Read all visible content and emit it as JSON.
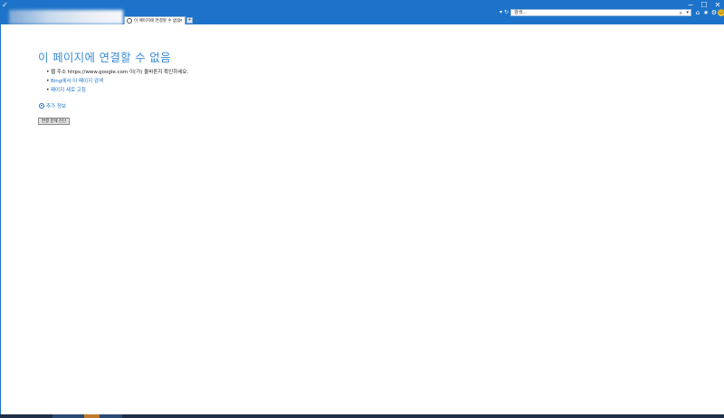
{
  "window": {
    "minimize_glyph": "−",
    "maximize_glyph": "☐",
    "close_glyph": "✕"
  },
  "address_bar": {
    "dropdown_glyph": "▾",
    "refresh_glyph": "↻"
  },
  "search": {
    "placeholder": "검색...",
    "icon": "search-icon",
    "dropdown_glyph": "▾"
  },
  "toolbar": {
    "home_glyph": "⌂",
    "favorites_glyph": "★",
    "tools_glyph": "⚙",
    "feedback_glyph": "☺"
  },
  "tabs": [
    {
      "label": "이 페이지에 연결할 수 없음",
      "close_glyph": "×"
    }
  ],
  "new_tab_glyph": "+",
  "error_page": {
    "title": "이 페이지에 연결할 수 없음",
    "bullets": [
      {
        "text": "웹 주소 https://www.google.com 이(가) 올바른지 확인하세요.",
        "link": false
      },
      {
        "text": "Bing에서 이 페이지 검색",
        "link": true
      },
      {
        "text": "페이지 새로 고침",
        "link": true
      }
    ],
    "more_info_label": "추가 정보",
    "more_info_glyph": "▾",
    "diagnose_button": "연결 문제 진단"
  },
  "colors": {
    "chrome": "#1c73c9",
    "title": "#3a8cd6",
    "link": "#1a73c7"
  }
}
